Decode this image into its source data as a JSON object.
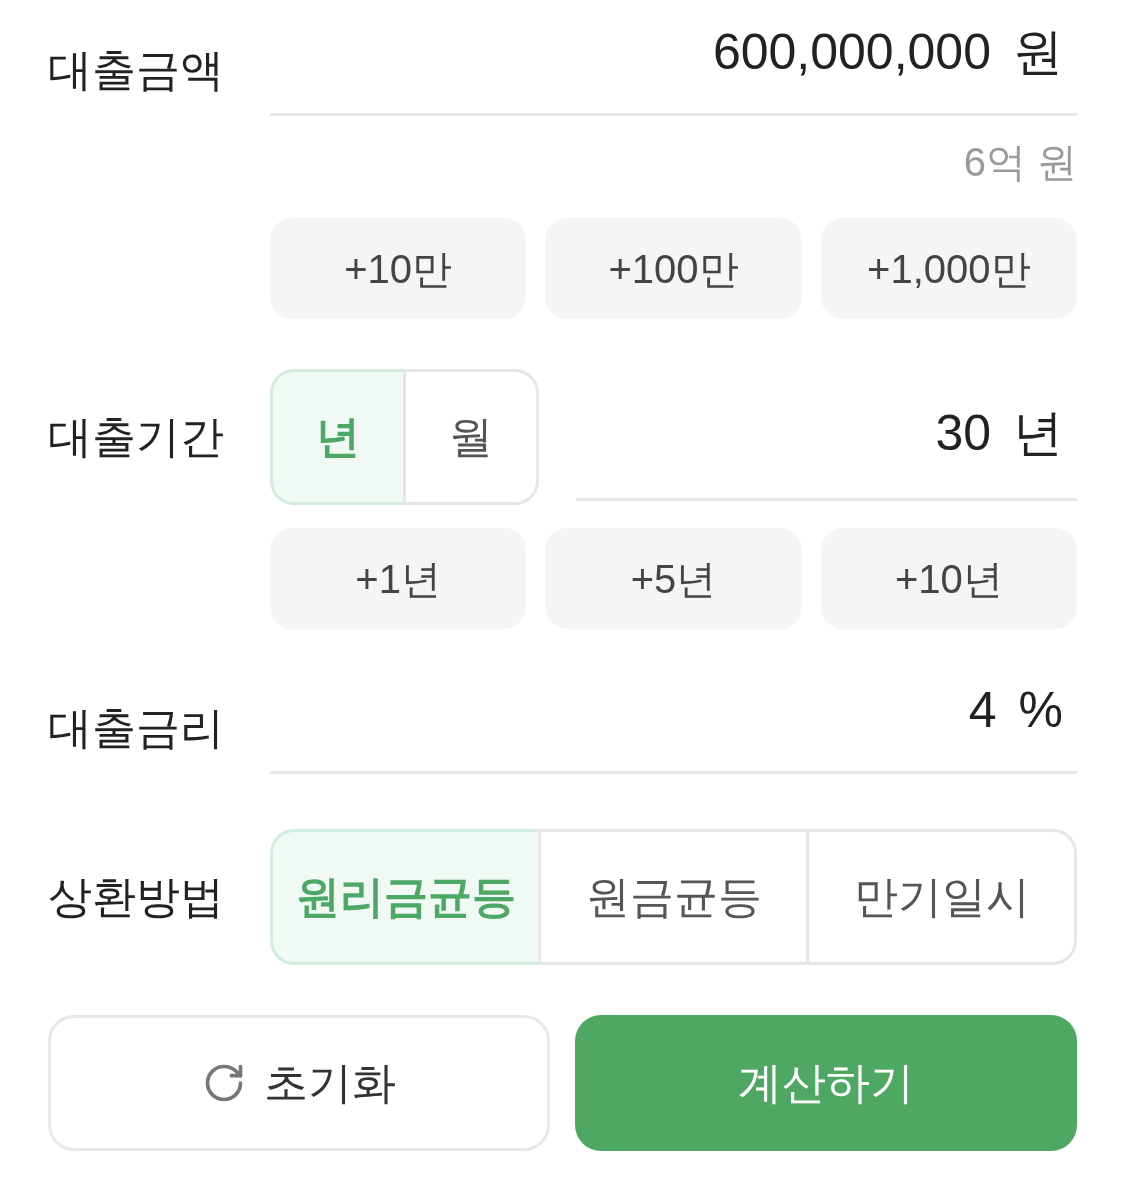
{
  "loan_amount": {
    "label": "대출금액",
    "value": "600,000,000",
    "unit": "원",
    "hint": "6억 원",
    "quick_buttons": [
      "+10만",
      "+100만",
      "+1,000만"
    ]
  },
  "loan_period": {
    "label": "대출기간",
    "unit_toggle": [
      {
        "label": "년",
        "selected": true
      },
      {
        "label": "월",
        "selected": false
      }
    ],
    "value": "30",
    "unit": "년",
    "quick_buttons": [
      "+1년",
      "+5년",
      "+10년"
    ]
  },
  "interest_rate": {
    "label": "대출금리",
    "value": "4",
    "unit": "%"
  },
  "repayment_method": {
    "label": "상환방법",
    "options": [
      {
        "label": "원리금균등",
        "selected": true
      },
      {
        "label": "원금균등",
        "selected": false
      },
      {
        "label": "만기일시",
        "selected": false
      }
    ]
  },
  "actions": [
    {
      "kind": "reset",
      "label": "초기화"
    },
    {
      "kind": "submit",
      "label": "계산하기"
    }
  ]
}
